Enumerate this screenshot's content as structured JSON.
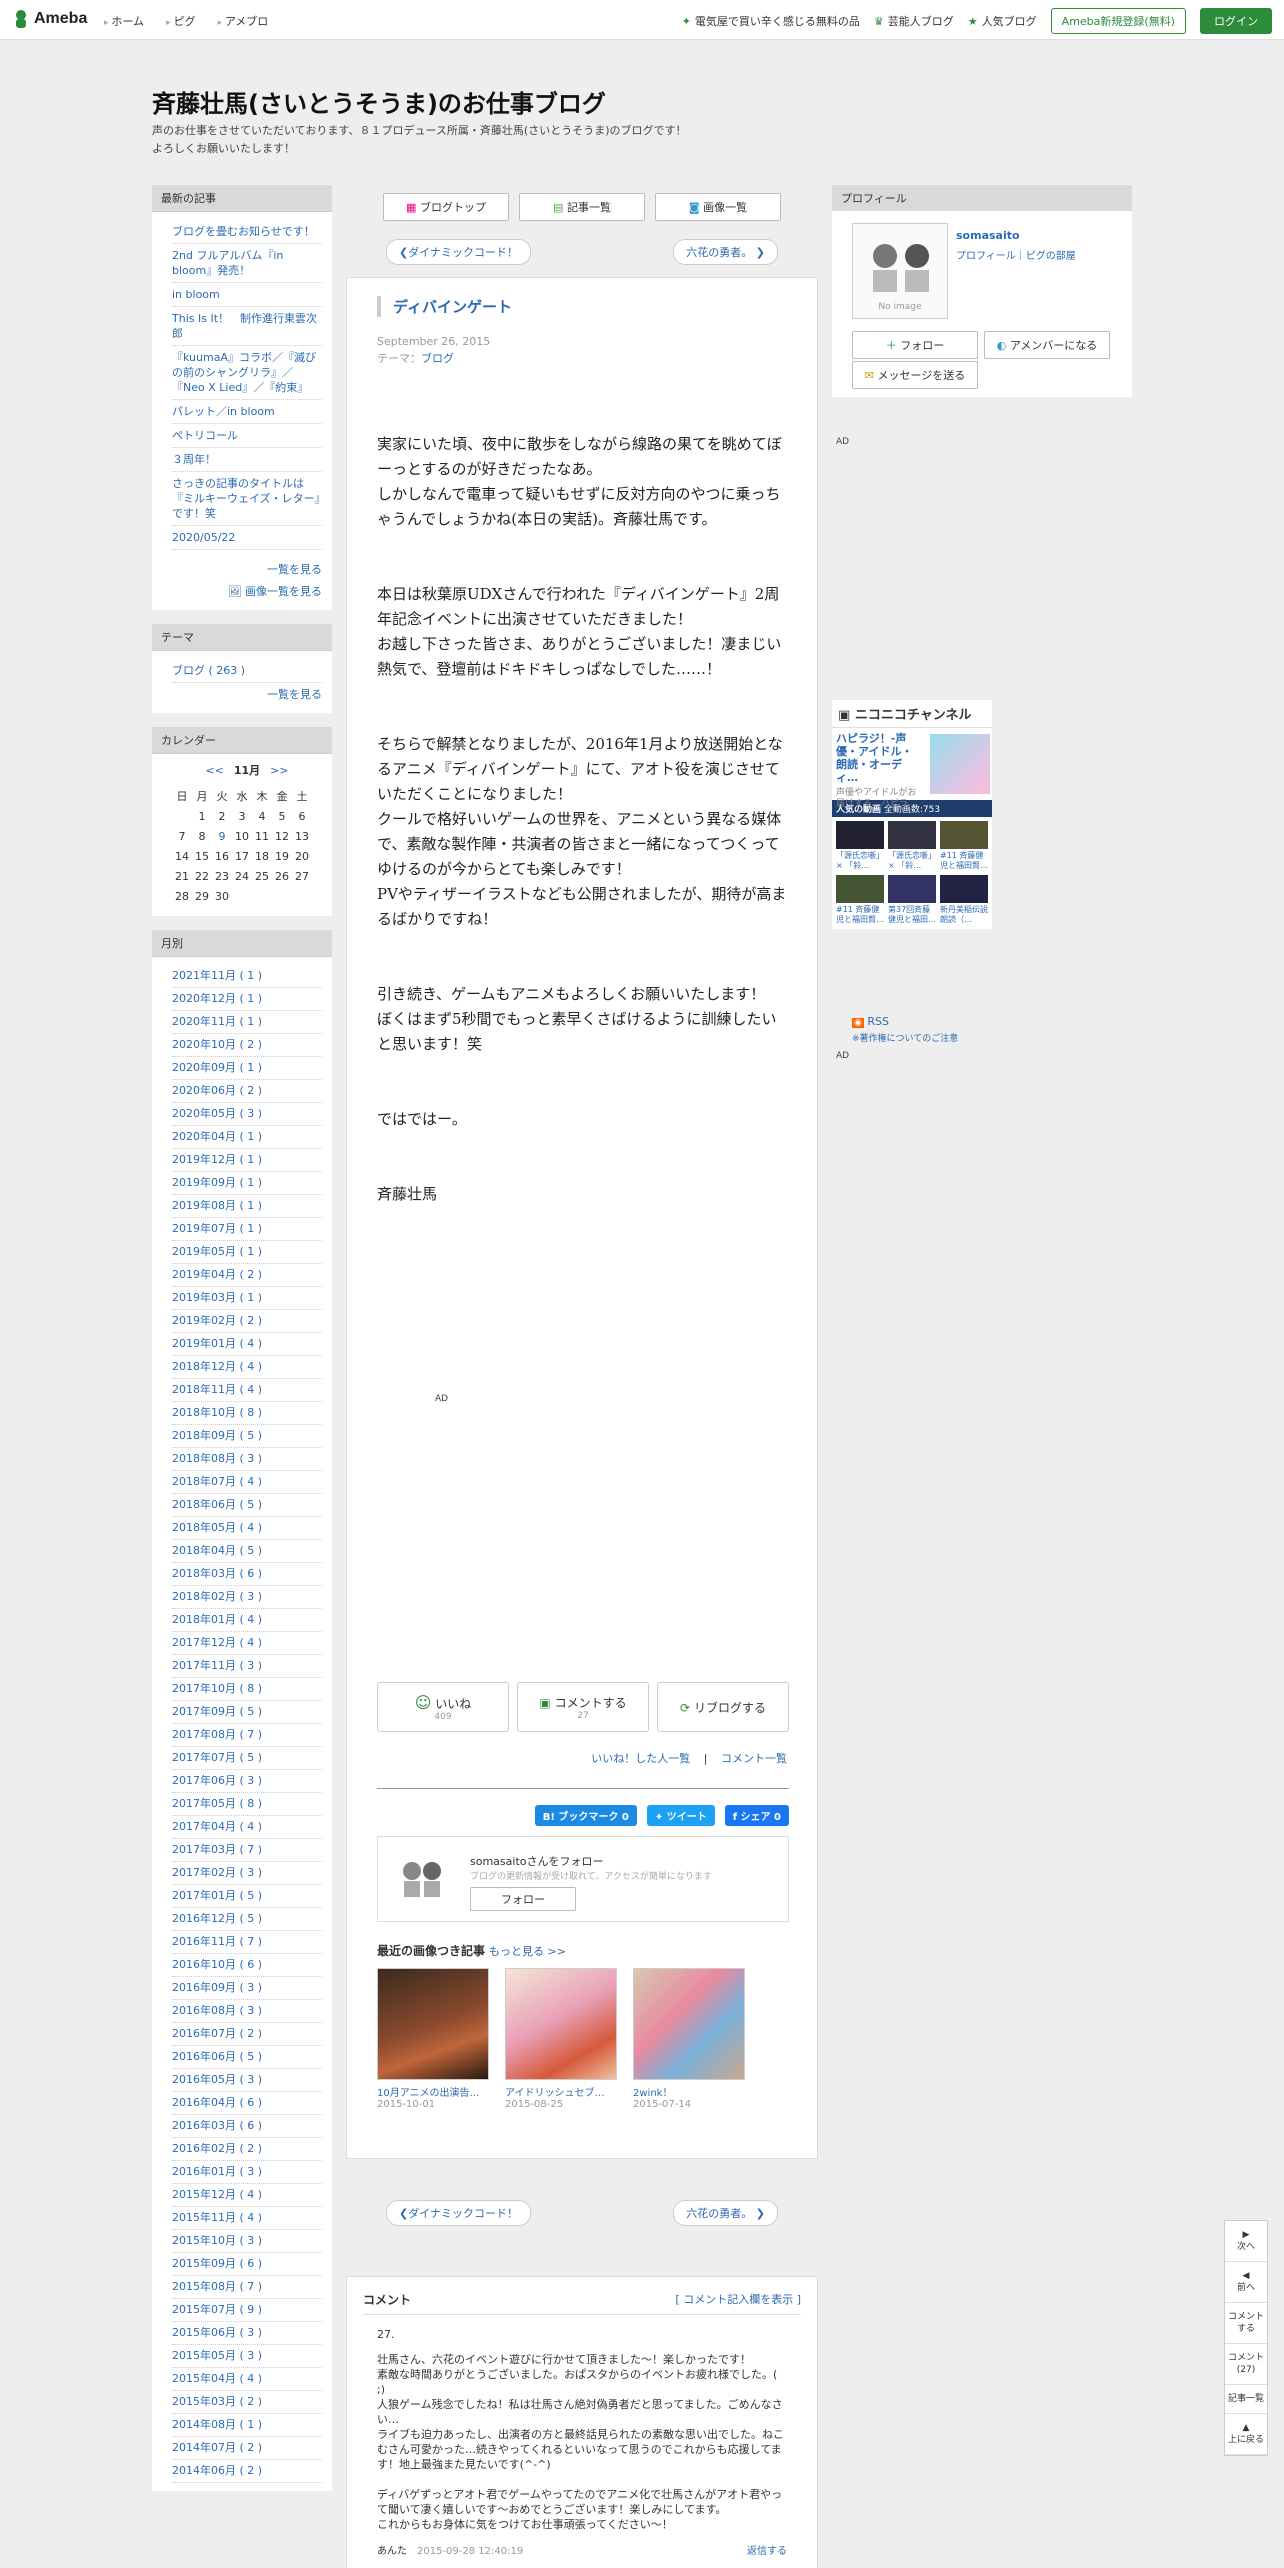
{
  "topbar": {
    "logo": "Ameba",
    "nav": [
      "ホーム",
      "ピグ",
      "アメブロ"
    ],
    "right_links": [
      "電気屋で買い辛く感じる無料の品",
      "芸能人ブログ",
      "人気ブログ"
    ],
    "register": "Ameba新規登録(無料)",
    "login": "ログイン"
  },
  "blog": {
    "title": "斉藤壮馬(さいとうそうま)のお仕事ブログ",
    "desc": "声のお仕事をさせていただいております、８１プロデュース所属・斉藤壮馬(さいとうそうま)のブログです！\nよろしくお願いいたします！"
  },
  "left": {
    "recent_header": "最新の記事",
    "recent": [
      "ブログを畳むお知らせです！",
      "2nd フルアルバム『in bloom』発売！",
      "in bloom",
      "This Is It！　制作進行東雲次郎",
      "『kuumaA』コラボ／『滅びの前のシャングリラ』／『Neo X Lied』／『約束』",
      "パレット／in bloom",
      "ペトリコール",
      "３周年！",
      "さっきの記事のタイトルは『ミルキーウェイズ・レター』です！笑",
      "2020/05/22"
    ],
    "recent_more": "一覧を見る",
    "recent_img_more": "画像一覧を見る",
    "theme_header": "テーマ",
    "theme_item": "ブログ ( 263 )",
    "theme_more": "一覧を見る",
    "cal_header": "カレンダー",
    "cal_prev": "<<",
    "cal_month": "11月",
    "cal_next": ">>",
    "cal_days": [
      "日",
      "月",
      "火",
      "水",
      "木",
      "金",
      "土"
    ],
    "cal_rows": [
      [
        "",
        "1",
        "2",
        "3",
        "4",
        "5",
        "6"
      ],
      [
        "7",
        "8",
        "9",
        "10",
        "11",
        "12",
        "13"
      ],
      [
        "14",
        "15",
        "16",
        "17",
        "18",
        "19",
        "20"
      ],
      [
        "21",
        "22",
        "23",
        "24",
        "25",
        "26",
        "27"
      ],
      [
        "28",
        "29",
        "30",
        "",
        "",
        "",
        ""
      ]
    ],
    "month_header": "月別",
    "months": [
      "2021年11月 ( 1 )",
      "2020年12月 ( 1 )",
      "2020年11月 ( 1 )",
      "2020年10月 ( 2 )",
      "2020年09月 ( 1 )",
      "2020年06月 ( 2 )",
      "2020年05月 ( 3 )",
      "2020年04月 ( 1 )",
      "2019年12月 ( 1 )",
      "2019年09月 ( 1 )",
      "2019年08月 ( 1 )",
      "2019年07月 ( 1 )",
      "2019年05月 ( 1 )",
      "2019年04月 ( 2 )",
      "2019年03月 ( 1 )",
      "2019年02月 ( 2 )",
      "2019年01月 ( 4 )",
      "2018年12月 ( 4 )",
      "2018年11月 ( 4 )",
      "2018年10月 ( 8 )",
      "2018年09月 ( 5 )",
      "2018年08月 ( 3 )",
      "2018年07月 ( 4 )",
      "2018年06月 ( 5 )",
      "2018年05月 ( 4 )",
      "2018年04月 ( 5 )",
      "2018年03月 ( 6 )",
      "2018年02月 ( 3 )",
      "2018年01月 ( 4 )",
      "2017年12月 ( 4 )",
      "2017年11月 ( 3 )",
      "2017年10月 ( 8 )",
      "2017年09月 ( 5 )",
      "2017年08月 ( 7 )",
      "2017年07月 ( 5 )",
      "2017年06月 ( 3 )",
      "2017年05月 ( 8 )",
      "2017年04月 ( 4 )",
      "2017年03月 ( 7 )",
      "2017年02月 ( 3 )",
      "2017年01月 ( 5 )",
      "2016年12月 ( 5 )",
      "2016年11月 ( 7 )",
      "2016年10月 ( 6 )",
      "2016年09月 ( 3 )",
      "2016年08月 ( 3 )",
      "2016年07月 ( 2 )",
      "2016年06月 ( 5 )",
      "2016年05月 ( 3 )",
      "2016年04月 ( 6 )",
      "2016年03月 ( 6 )",
      "2016年02月 ( 2 )",
      "2016年01月 ( 3 )",
      "2015年12月 ( 4 )",
      "2015年11月 ( 4 )",
      "2015年10月 ( 3 )",
      "2015年09月 ( 6 )",
      "2015年08月 ( 7 )",
      "2015年07月 ( 9 )",
      "2015年06月 ( 3 )",
      "2015年05月 ( 3 )",
      "2015年04月 ( 4 )",
      "2015年03月 ( 2 )",
      "2014年08月 ( 1 )",
      "2014年07月 ( 2 )",
      "2014年06月 ( 2 )"
    ]
  },
  "main": {
    "btn_top": "ブログトップ",
    "btn_list": "記事一覧",
    "btn_images": "画像一覧",
    "prev": "ダイナミックコード！",
    "next": "六花の勇者。",
    "title": "ディバインゲート",
    "date": "September 26, 2015",
    "theme_label": "テーマ：",
    "theme": "ブログ",
    "paragraphs": [
      "実家にいた頃、夜中に散歩をしながら線路の果てを眺めてぼーっとするのが好きだったなあ。\nしかしなんで電車って疑いもせずに反対方向のやつに乗っちゃうんでしょうかね(本日の実話)。斉藤壮馬です。",
      "本日は秋葉原UDXさんで行われた『ディバインゲート』2周年記念イベントに出演させていただきました！\nお越し下さった皆さま、ありがとうございました！凄まじい熱気で、登壇前はドキドキしっぱなしでした……！",
      "そちらで解禁となりましたが、2016年1月より放送開始となるアニメ『ディバインゲート』にて、アオト役を演じさせていただくことになりました！\nクールで格好いいゲームの世界を、アニメという異なる媒体で、素敵な製作陣・共演者の皆さまと一緒になってつくってゆけるのが今からとても楽しみです！\nPVやティザーイラストなども公開されましたが、期待が高まるばかりですね！",
      "引き続き、ゲームもアニメもよろしくお願いいたします！\nぼくはまず5秒間でもっと素早くさばけるように訓練したいと思います！笑",
      "ではではー。",
      "斉藤壮馬"
    ],
    "ad": "AD",
    "like": "いいね",
    "like_count": "409",
    "comment": "コメントする",
    "comment_count": "27",
    "reblog": "リブログする",
    "liked_people": "いいね！した人一覧",
    "comment_list": "コメント一覧",
    "share_hatena": "B! ブックマーク  0",
    "share_tweet": "ツイート",
    "share_fb": "シェア 0",
    "follow_name": "somasaitoさんをフォロー",
    "follow_desc": "ブログの更新情報が受け取れて、アクセスが簡単になります",
    "follow_btn": "フォロー",
    "recent_imgs_header": "最近の画像つき記事",
    "recent_imgs_more": "もっと見る >>",
    "recent_imgs": [
      {
        "title": "10月アニメの出演告…",
        "date": "2015-10-01"
      },
      {
        "title": "アイドリッシュセブ…",
        "date": "2015-08-25"
      },
      {
        "title": "2wink！",
        "date": "2015-07-14"
      }
    ]
  },
  "comments": {
    "header": "コメント",
    "open": "[ コメント記入欄を表示 ]",
    "num": "27.",
    "body": "壮馬さん、六花のイベント遊びに行かせて頂きました～！楽しかったです！\n素敵な時間ありがとうございました。おぱスタからのイベントお疲れ様でした。( ;)\n人狼ゲーム残念でしたね！私は壮馬さん絶対偽勇者だと思ってました。ごめんなさい…\nライブも迫力あったし、出演者の方と最終話見られたの素敵な思い出でした。ねこむさん可愛かった…続きやってくれるといいなって思うのでこれからも応援してます！地上最強また見たいです(^-^)\n\nディバゲずっとアオト君でゲームやってたのでアニメ化で壮馬さんがアオト君やって聞いて凄く嬉しいです～おめでとうございます！楽しみにしてます。\nこれからもお身体に気をつけてお仕事頑張ってください～！",
    "author": "あんた",
    "time": "2015-09-28 12:40:19",
    "reply": "返信する"
  },
  "right": {
    "profile_header": "プロフィール",
    "name": "somasaito",
    "links": "プロフィール｜ピグの部屋",
    "no_image": "No image",
    "follow": "フォロー",
    "member": "アメンバーになる",
    "message": "メッセージを送る",
    "ad": "AD",
    "nico_logo": "ニコニコチャンネル",
    "nico_title": "ハピラジ！-声優・アイドル・朗読・オーディ…",
    "nico_desc": "声優やアイドルがお届けする、ハピラ…",
    "nico_bar": "人気の動画",
    "nico_count": "全動画数:753",
    "nico_items": [
      "「源氏恋噺」× 「鈴…",
      "「源氏恋噺」× 「鈴…",
      "#11 斉藤健児と福田賢…",
      "#11 斉藤健児と福田賢…",
      "第37回斉藤健児と福田…",
      "新丹美稲伝説　朗読（…"
    ],
    "rss": "RSS",
    "rss_note": "※著作権についてのご注意",
    "ad2": "AD"
  },
  "floatnav": [
    "次へ",
    "前へ",
    "コメントする",
    "コメント(27)",
    "記事一覧",
    "上に戻る"
  ]
}
